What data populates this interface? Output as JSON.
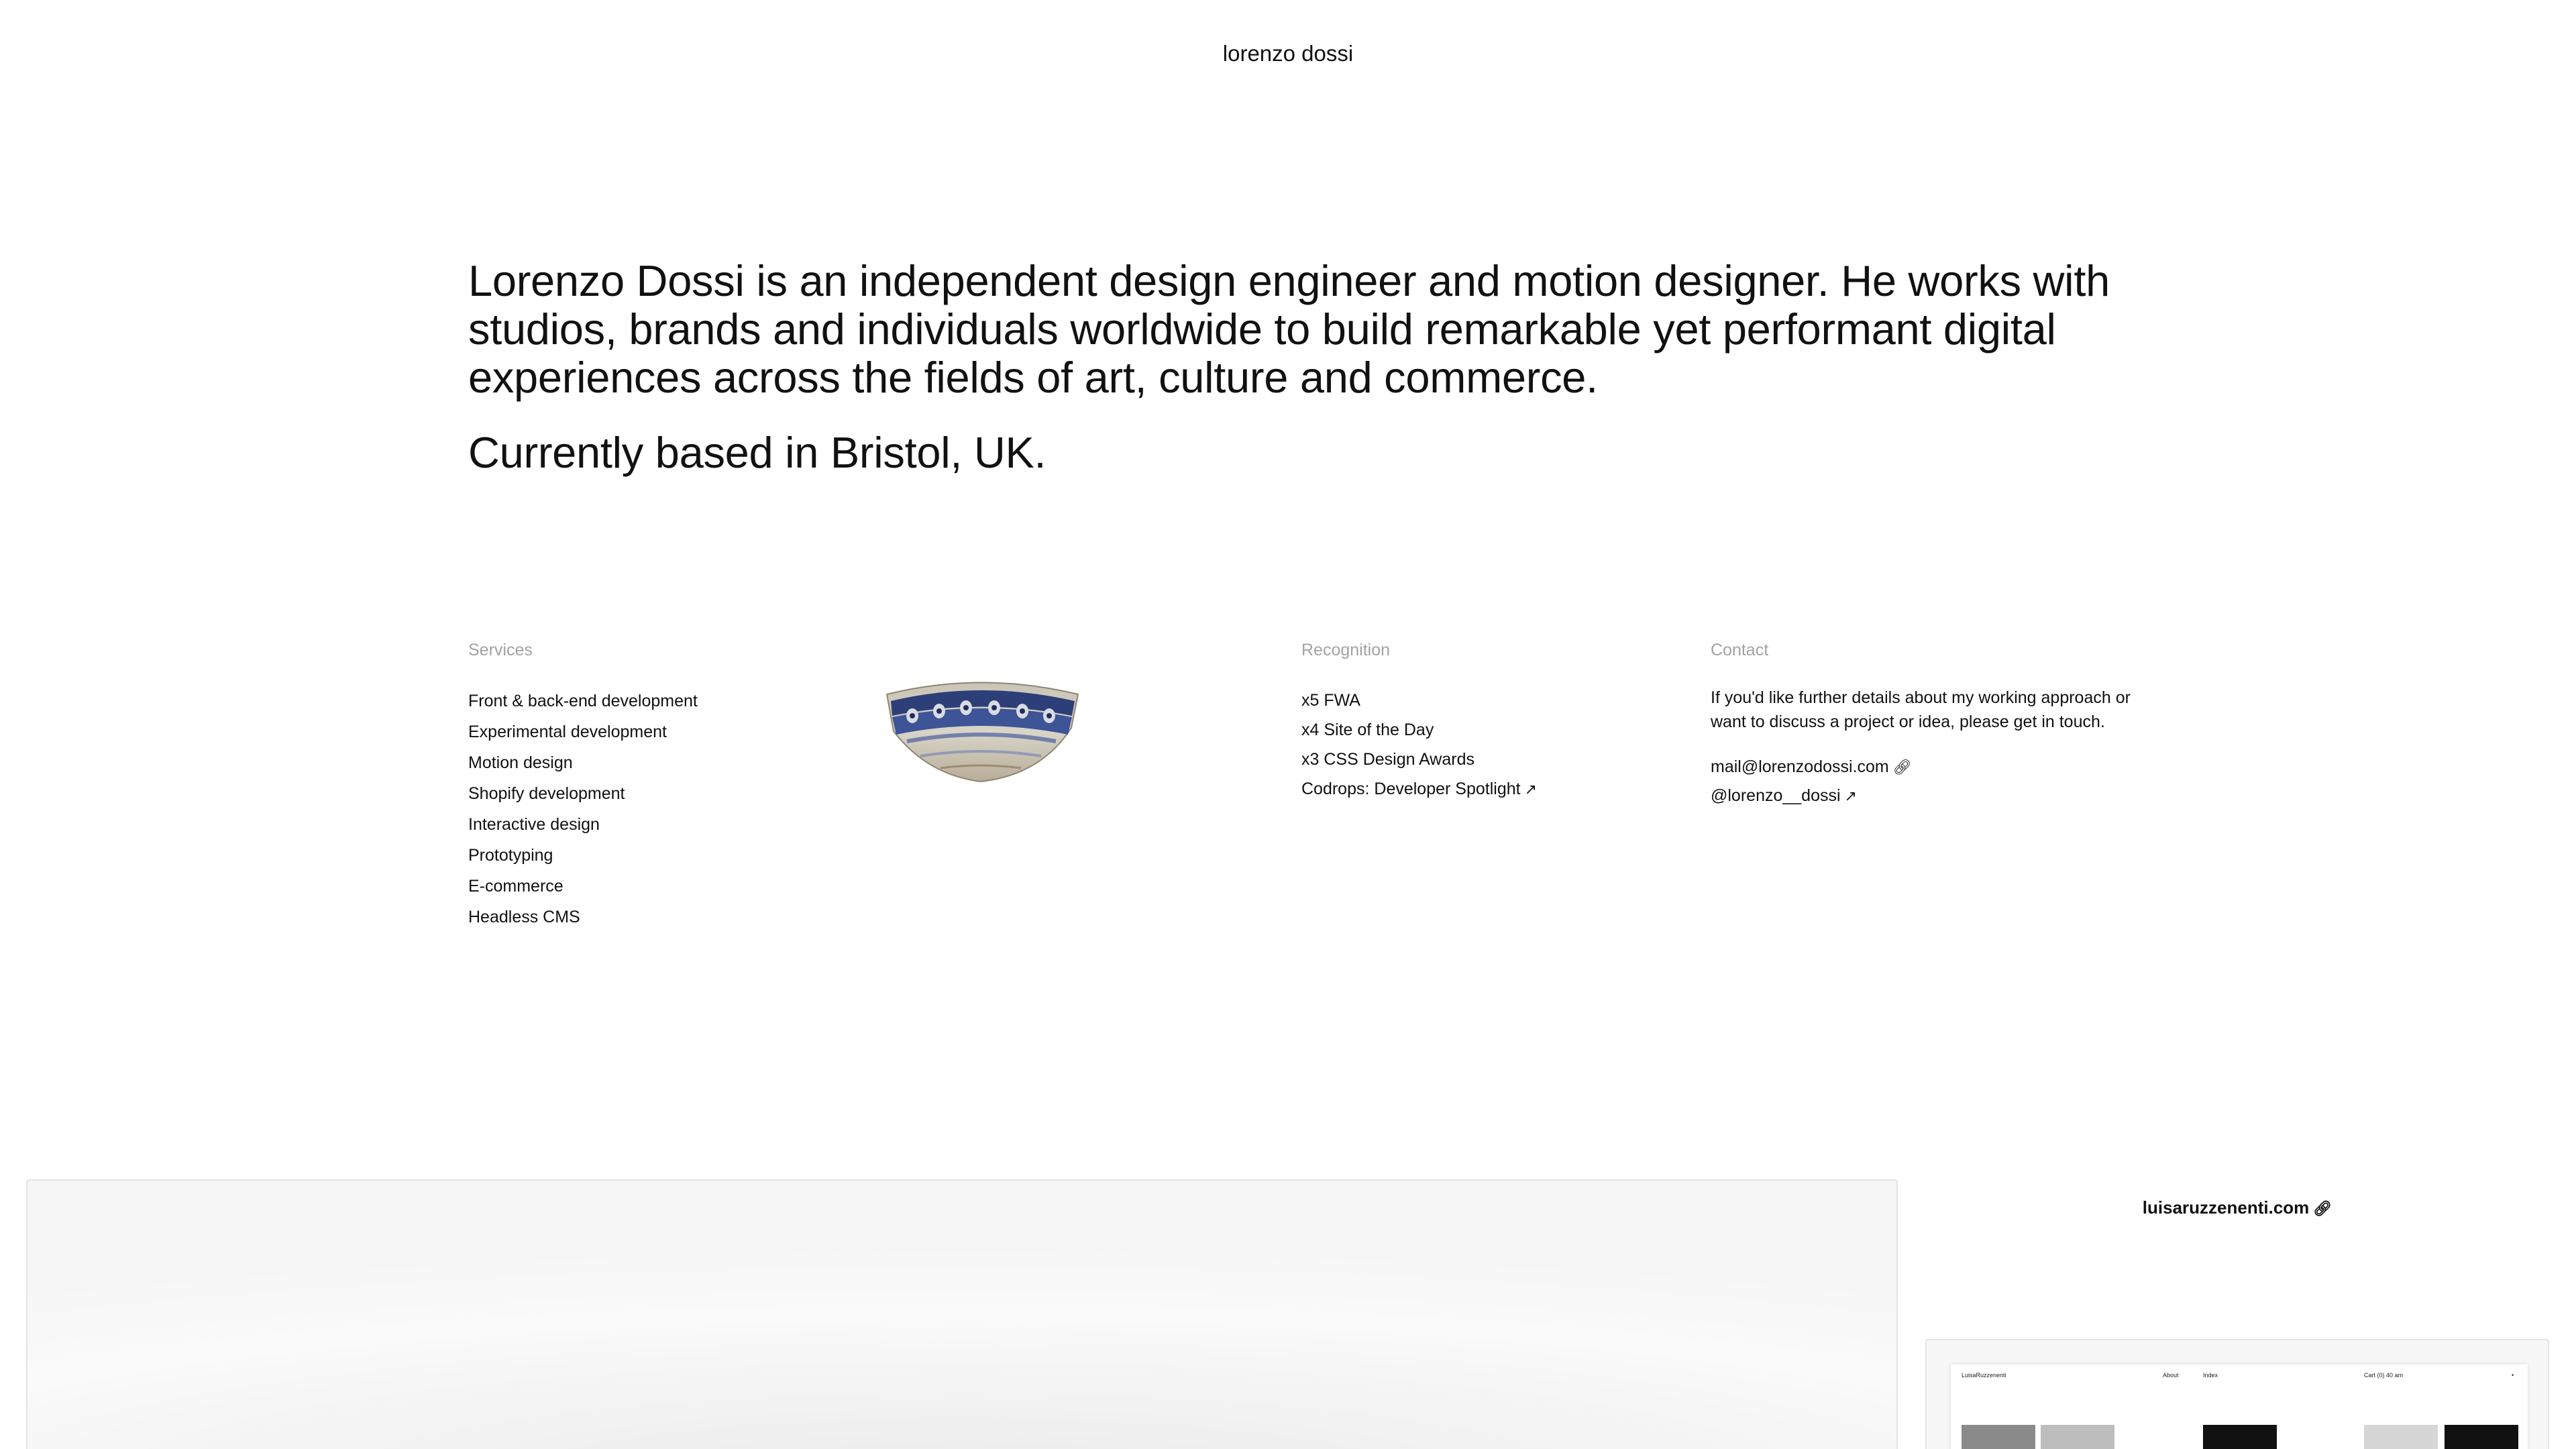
{
  "header": {
    "site_title": "lorenzo dossi"
  },
  "intro": {
    "paragraph": "Lorenzo Dossi is an independent design engineer and motion designer. He works with studios, brands and individuals worldwide to build remarkable yet performant digital experiences across the fields of art, culture and commerce.",
    "location": "Currently based in Bristol, UK."
  },
  "services": {
    "heading": "Services",
    "items": [
      "Front & back-end development",
      "Experimental development",
      "Motion design",
      "Shopify development",
      "Interactive design",
      "Prototyping",
      "E-commerce",
      "Headless CMS"
    ]
  },
  "recognition": {
    "heading": "Recognition",
    "items": [
      "x5 FWA",
      "x4 Site of the Day",
      "x3 CSS Design Awards"
    ],
    "link": "Codrops: Developer Spotlight"
  },
  "contact": {
    "heading": "Contact",
    "text": "If you'd like further details about my working approach or want to discuss a project or idea, please get in touch.",
    "email": "mail@lorenzodossi.com",
    "handle": "@lorenzo__dossi"
  },
  "project_preview": {
    "url_label": "luisaruzzenenti.com",
    "mini_nav": [
      "LuisaRuzzenenti",
      "About",
      "Index",
      "Cart (0) 40 am"
    ]
  },
  "icons": {
    "link": "link-icon",
    "external": "arrow-up-right-icon"
  },
  "colors": {
    "text": "#111111",
    "muted": "#a3a3a3",
    "background": "#ffffff"
  }
}
